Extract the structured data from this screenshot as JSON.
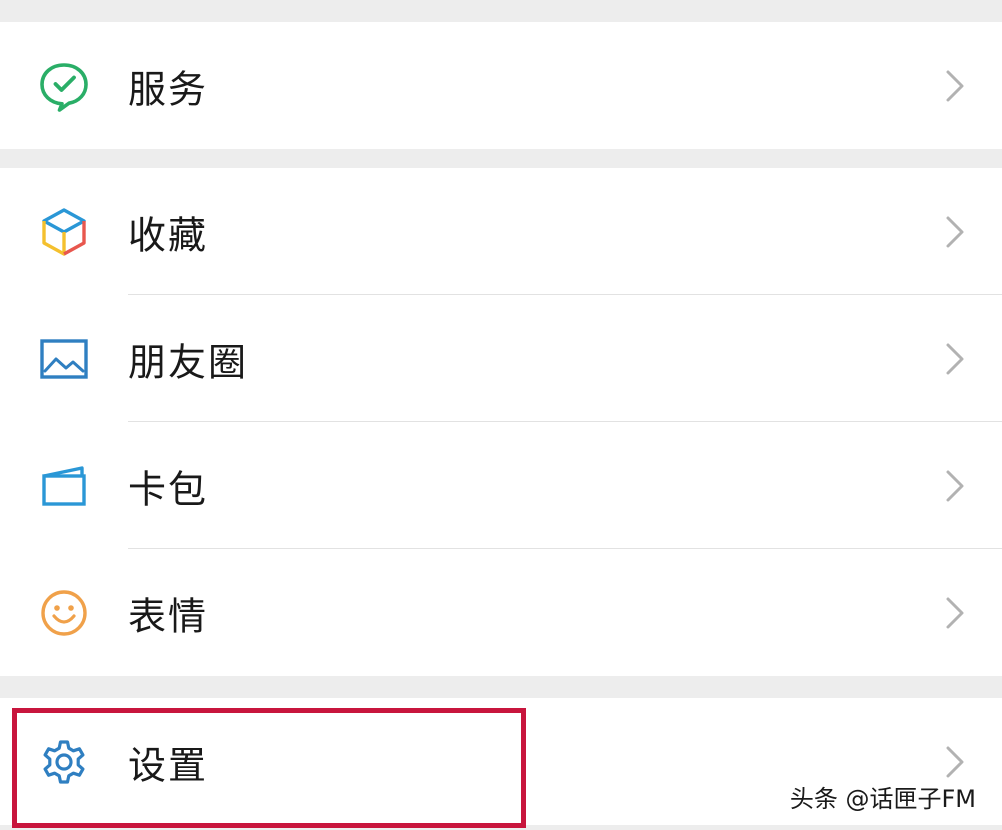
{
  "groups": [
    {
      "items": [
        {
          "label": "服务",
          "icon": "service-check-icon"
        }
      ]
    },
    {
      "items": [
        {
          "label": "收藏",
          "icon": "favorites-cube-icon"
        },
        {
          "label": "朋友圈",
          "icon": "moments-image-icon"
        },
        {
          "label": "卡包",
          "icon": "card-wallet-icon"
        },
        {
          "label": "表情",
          "icon": "sticker-smile-icon"
        }
      ]
    },
    {
      "items": [
        {
          "label": "设置",
          "icon": "settings-gear-icon"
        }
      ]
    }
  ],
  "chevron_icon": "chevron-right-icon",
  "highlight": {
    "target": "设置",
    "color": "#c8153d"
  },
  "watermark": "头条 @话匣子FM",
  "colors": {
    "background": "#ededed",
    "row": "#ffffff",
    "service_green": "#2aae67",
    "moments_blue": "#2f7fc1",
    "card_blue": "#2a97d6",
    "sticker_orange": "#f0a14a",
    "settings_blue": "#2f7fc1"
  }
}
